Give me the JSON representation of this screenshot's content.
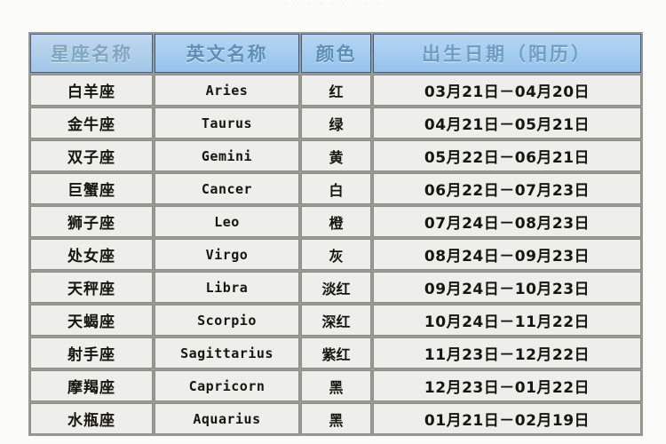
{
  "top_sliver_text": "·  ·  ·  ·        ·  ·        ·  ·  ·",
  "table": {
    "headers": [
      {
        "label": "星座名称",
        "key": "name"
      },
      {
        "label": "英文名称",
        "key": "english"
      },
      {
        "label": "颜色",
        "key": "color"
      },
      {
        "label": "出生日期（阳历）",
        "key": "birth_date"
      }
    ],
    "header_style": {
      "background_top": "#b6d6f2",
      "background_bottom": "#94c2ec",
      "text_color": "#5d8fb8",
      "border_color": "#3f5e86"
    },
    "body_style": {
      "cell_background": "#eeeeea",
      "cell_border": "#8d8d86",
      "text_color": "#16160f",
      "grid_background": "#9a9a94"
    },
    "rows": [
      {
        "name": "白羊座",
        "english": "Aries",
        "color": "红",
        "birth_date": "03月21日－04月20日"
      },
      {
        "name": "金牛座",
        "english": "Taurus",
        "color": "绿",
        "birth_date": "04月21日－05月21日"
      },
      {
        "name": "双子座",
        "english": "Gemini",
        "color": "黄",
        "birth_date": "05月22日－06月21日"
      },
      {
        "name": "巨蟹座",
        "english": "Cancer",
        "color": "白",
        "birth_date": "06月22日－07月23日"
      },
      {
        "name": "狮子座",
        "english": "Leo",
        "color": "橙",
        "birth_date": "07月24日－08月23日"
      },
      {
        "name": "处女座",
        "english": "Virgo",
        "color": "灰",
        "birth_date": "08月24日－09月23日"
      },
      {
        "name": "天秤座",
        "english": "Libra",
        "color": "淡红",
        "birth_date": "09月24日－10月23日"
      },
      {
        "name": "天蝎座",
        "english": "Scorpio",
        "color": "深红",
        "birth_date": "10月24日－11月22日"
      },
      {
        "name": "射手座",
        "english": "Sagittarius",
        "color": "紫红",
        "birth_date": "11月23日－12月22日"
      },
      {
        "name": "摩羯座",
        "english": "Capricorn",
        "color": "黑",
        "birth_date": "12月23日－01月22日"
      },
      {
        "name": "水瓶座",
        "english": "Aquarius",
        "color": "黑",
        "birth_date": "01月21日－02月19日"
      }
    ]
  }
}
